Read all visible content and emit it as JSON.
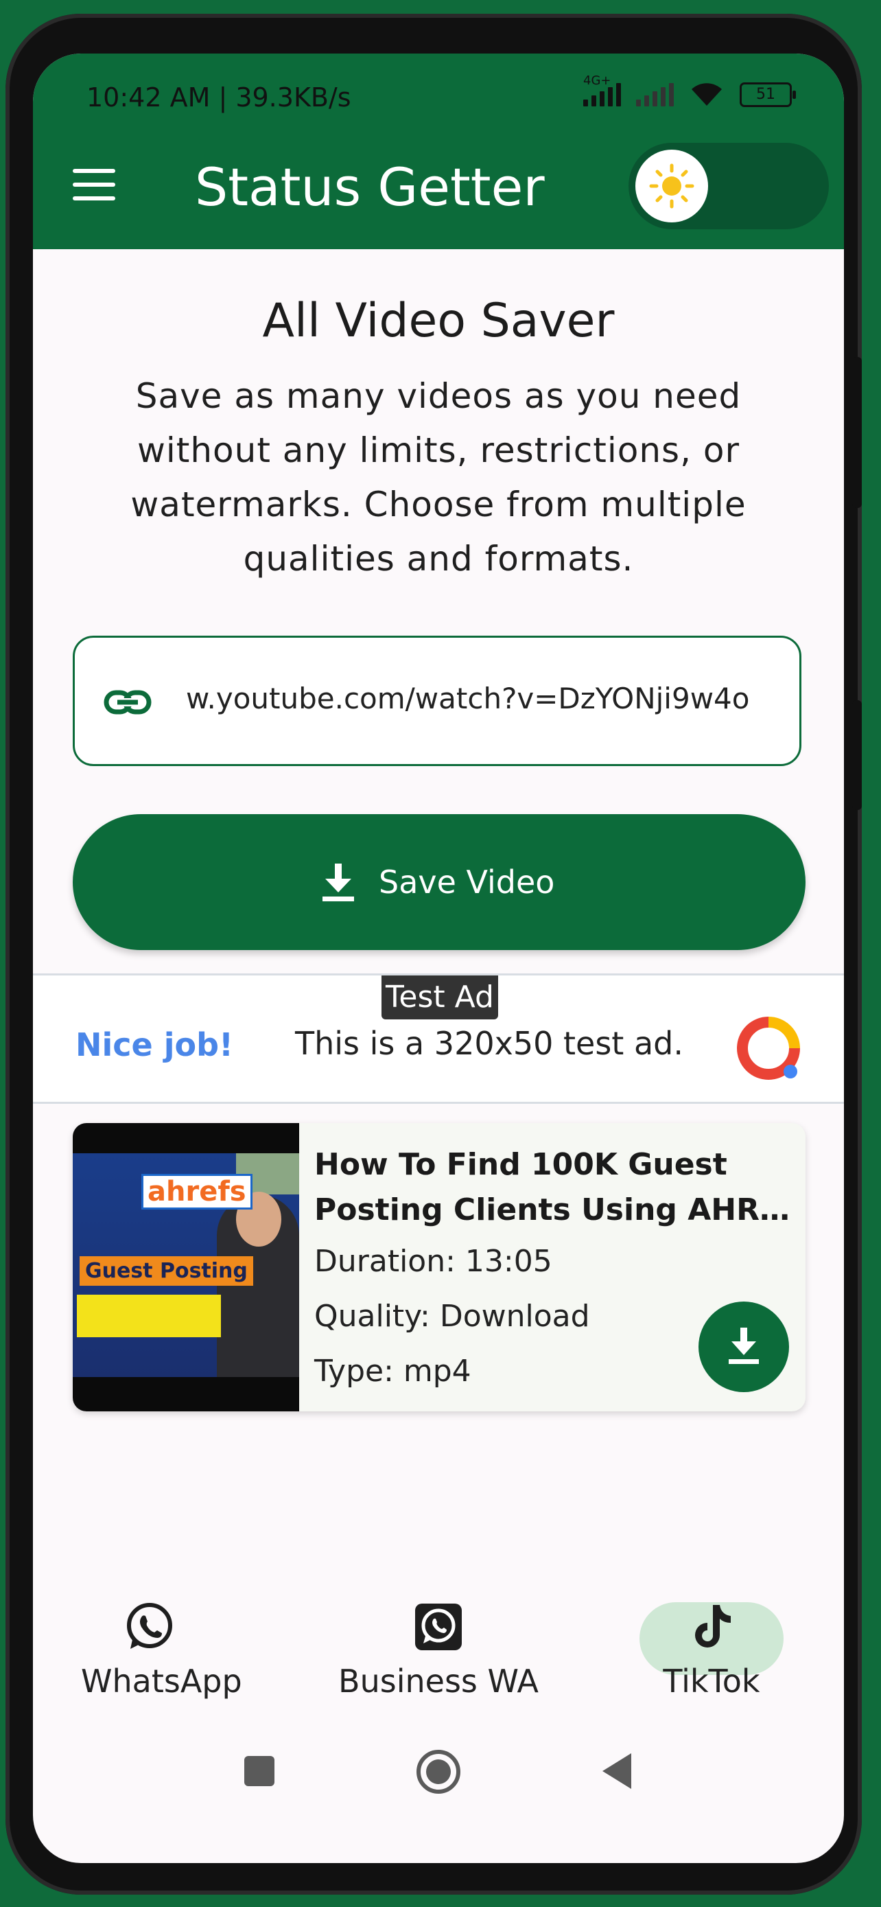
{
  "status_bar": {
    "time_speed": "10:42 AM | 39.3KB/s",
    "network_label": "4G+",
    "battery": "51"
  },
  "app_bar": {
    "title": "Status Getter"
  },
  "main": {
    "heading": "All Video Saver",
    "description": "Save as many videos as you need without any limits, restrictions, or watermarks. Choose from multiple qualities and formats.",
    "url_value": "w.youtube.com/watch?v=DzYONji9w4o",
    "save_button_label": "Save Video"
  },
  "ad": {
    "badge": "Test Ad",
    "nice": "Nice job!",
    "text": "This is a 320x50 test ad."
  },
  "video_card": {
    "title_line1": "How To Find 100K Guest",
    "title_line2": "Posting Clients Using AHREFS ...",
    "duration": "Duration: 13:05",
    "quality": "Quality: Download",
    "type": "Type: mp4",
    "thumbnail_brand": "ahrefs",
    "thumbnail_banner": "Guest Posting"
  },
  "bottom_nav": {
    "items": [
      {
        "label": "WhatsApp",
        "icon": "whatsapp-icon"
      },
      {
        "label": "Business WA",
        "icon": "business-whatsapp-icon"
      },
      {
        "label": "TikTok",
        "icon": "tiktok-icon",
        "selected": true
      }
    ]
  },
  "colors": {
    "primary": "#0c6b3a",
    "selected_pill": "#cfe8d5",
    "ad_accent": "#4a86e8"
  }
}
